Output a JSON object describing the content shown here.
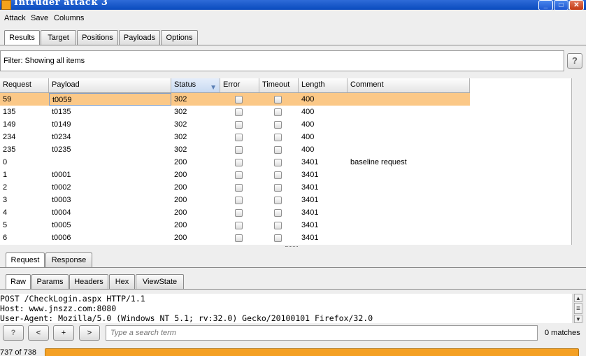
{
  "window": {
    "title": "Intruder attack 3",
    "min": "_",
    "max": "□",
    "close": "✕"
  },
  "menu": [
    "Attack",
    "Save",
    "Columns"
  ],
  "top_tabs": [
    {
      "label": "Results",
      "active": true
    },
    {
      "label": "Target",
      "active": false
    },
    {
      "label": "Positions",
      "active": false
    },
    {
      "label": "Payloads",
      "active": false
    },
    {
      "label": "Options",
      "active": false
    }
  ],
  "filter": {
    "text": "Filter:  Showing all items",
    "help": "?"
  },
  "table": {
    "columns": [
      "Request",
      "Payload",
      "Status",
      "Error",
      "Timeout",
      "Length",
      "Comment"
    ],
    "sorted_column": "Status",
    "rows": [
      {
        "request": "59",
        "payload": "t0059",
        "status": "302",
        "length": "400",
        "comment": "",
        "selected": true
      },
      {
        "request": "135",
        "payload": "t0135",
        "status": "302",
        "length": "400",
        "comment": ""
      },
      {
        "request": "149",
        "payload": "t0149",
        "status": "302",
        "length": "400",
        "comment": ""
      },
      {
        "request": "234",
        "payload": "t0234",
        "status": "302",
        "length": "400",
        "comment": ""
      },
      {
        "request": "235",
        "payload": "t0235",
        "status": "302",
        "length": "400",
        "comment": ""
      },
      {
        "request": "0",
        "payload": "",
        "status": "200",
        "length": "3401",
        "comment": "baseline request"
      },
      {
        "request": "1",
        "payload": "t0001",
        "status": "200",
        "length": "3401",
        "comment": ""
      },
      {
        "request": "2",
        "payload": "t0002",
        "status": "200",
        "length": "3401",
        "comment": ""
      },
      {
        "request": "3",
        "payload": "t0003",
        "status": "200",
        "length": "3401",
        "comment": ""
      },
      {
        "request": "4",
        "payload": "t0004",
        "status": "200",
        "length": "3401",
        "comment": ""
      },
      {
        "request": "5",
        "payload": "t0005",
        "status": "200",
        "length": "3401",
        "comment": ""
      },
      {
        "request": "6",
        "payload": "t0006",
        "status": "200",
        "length": "3401",
        "comment": ""
      }
    ]
  },
  "reqresp_tabs": [
    {
      "label": "Request",
      "active": true
    },
    {
      "label": "Response",
      "active": false
    }
  ],
  "view_tabs": [
    {
      "label": "Raw",
      "active": true
    },
    {
      "label": "Params",
      "active": false
    },
    {
      "label": "Headers",
      "active": false
    },
    {
      "label": "Hex",
      "active": false
    },
    {
      "label": "ViewState",
      "active": false
    }
  ],
  "raw_lines": [
    "POST /CheckLogin.aspx HTTP/1.1",
    "Host: www.jnszz.com:8080",
    "User-Agent: Mozilla/5.0 (Windows NT 5.1; rv:32.0) Gecko/20100101 Firefox/32.0"
  ],
  "search": {
    "help": "?",
    "prev": "<",
    "add": "+",
    "next": ">",
    "placeholder": "Type a search term",
    "matches": "0 matches"
  },
  "status": {
    "progress_text": "737 of 738",
    "progress_fraction": 0.9986
  },
  "colors": {
    "selected_row": "#fbc887",
    "progress": "#f4a024",
    "titlebar": "#0a4bbd"
  }
}
